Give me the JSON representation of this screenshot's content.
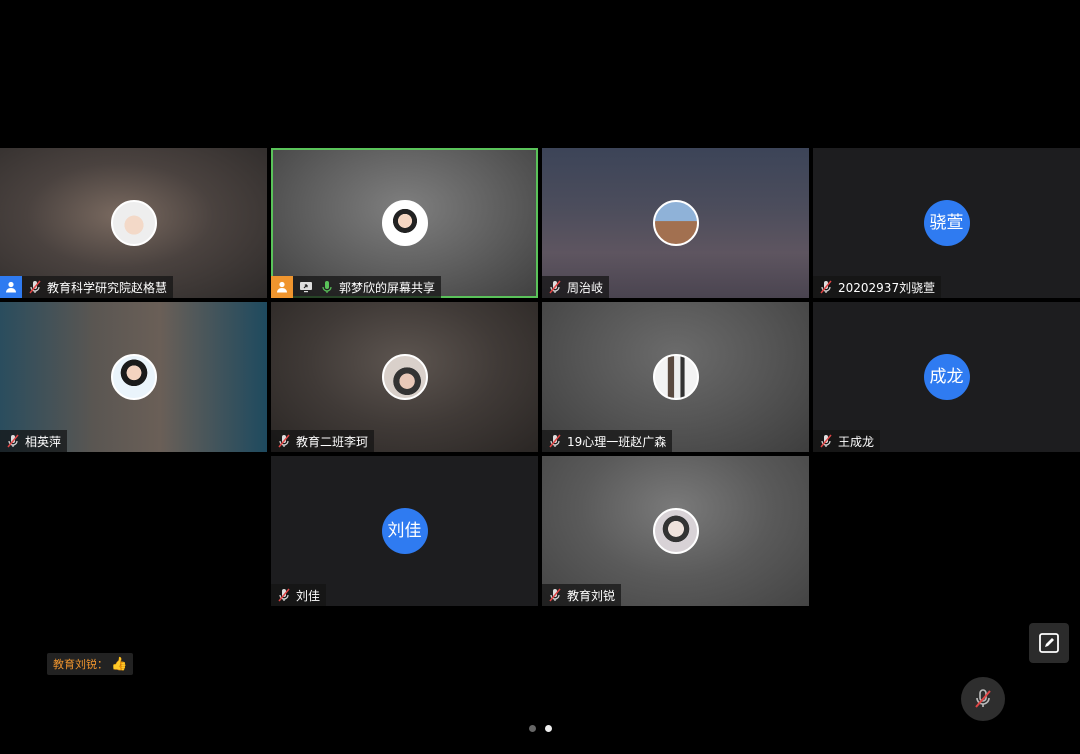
{
  "participants": [
    {
      "name": "教育科学研究院赵格慧",
      "role": "host",
      "mic": "muted",
      "avatar": "photo"
    },
    {
      "name": "郭梦欣的屏幕共享",
      "role": "cohost",
      "mic": "on",
      "sharing": true,
      "speaking": true,
      "avatar": "photo"
    },
    {
      "name": "周治岐",
      "mic": "muted",
      "avatar": "photo"
    },
    {
      "name": "20202937刘骁萱",
      "mic": "muted",
      "initials": "骁萱"
    },
    {
      "name": "相英萍",
      "mic": "muted",
      "avatar": "photo"
    },
    {
      "name": "教育二班李珂",
      "mic": "muted",
      "avatar": "photo"
    },
    {
      "name": "19心理一班赵广森",
      "mic": "muted",
      "avatar": "photo"
    },
    {
      "name": "王成龙",
      "mic": "muted",
      "initials": "成龙"
    },
    {
      "name": "刘佳",
      "mic": "muted",
      "initials": "刘佳"
    },
    {
      "name": "教育刘锐",
      "mic": "muted",
      "avatar": "photo"
    }
  ],
  "reaction": {
    "sender": "教育刘锐：",
    "emoji": "👍"
  },
  "controls": {
    "edit_icon": "annotate-icon",
    "mute_icon": "mic-off-icon"
  },
  "pagination": {
    "current": 2,
    "total": 2
  },
  "colors": {
    "accent": "#2f7bf1",
    "cohost": "#f0952e",
    "active_speaker": "#5ac35a",
    "mic_on": "#5ac35a"
  }
}
